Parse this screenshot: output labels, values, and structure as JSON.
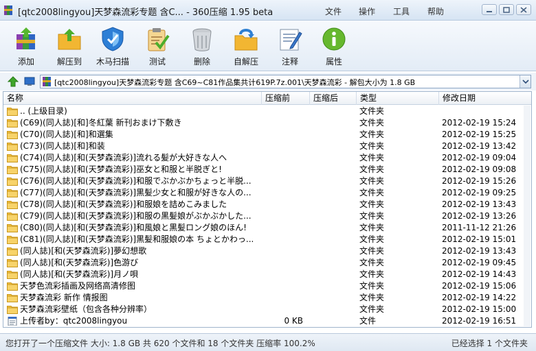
{
  "window": {
    "title": "[qtc2008lingyou]天梦森流彩专题 含C... - 360压缩 1.95 beta",
    "menu": [
      "文件",
      "操作",
      "工具",
      "帮助"
    ]
  },
  "toolbar": {
    "buttons": [
      {
        "label": "添加",
        "icon": "add-archive-icon"
      },
      {
        "label": "解压到",
        "icon": "extract-to-icon"
      },
      {
        "label": "木马扫描",
        "icon": "trojan-scan-shield-icon"
      },
      {
        "label": "测试",
        "icon": "test-clipboard-icon"
      },
      {
        "label": "删除",
        "icon": "trash-icon"
      },
      {
        "label": "自解压",
        "icon": "self-extract-icon"
      },
      {
        "label": "注释",
        "icon": "comment-icon"
      },
      {
        "label": "属性",
        "icon": "info-icon"
      }
    ]
  },
  "address": {
    "path": "[qtc2008lingyou]天梦森流彩专题 含C69~C81作品集共计619P.7z.001\\天梦森流彩 - 解包大小为 1.8 GB"
  },
  "table": {
    "headers": [
      "名称",
      "压缩前",
      "压缩后",
      "类型",
      "修改日期"
    ],
    "rows": [
      {
        "name": ".. (上级目录)",
        "before": "",
        "type": "文件夹",
        "date": "",
        "kind": "folder"
      },
      {
        "name": "(C69)(同人誌)[和]冬紅葉 新刊おまけ下敷き",
        "before": "",
        "type": "文件夹",
        "date": "2012-02-19 15:24",
        "kind": "folder"
      },
      {
        "name": "(C70)(同人誌)[和]和選集",
        "before": "",
        "type": "文件夹",
        "date": "2012-02-19 15:25",
        "kind": "folder"
      },
      {
        "name": "(C73)(同人誌)[和]和装",
        "before": "",
        "type": "文件夹",
        "date": "2012-02-19 13:42",
        "kind": "folder"
      },
      {
        "name": "(C74)(同人誌)[和(天梦森流彩)]流れる髪が大好きな人へ",
        "before": "",
        "type": "文件夹",
        "date": "2012-02-19 09:04",
        "kind": "folder"
      },
      {
        "name": "(C75)(同人誌)[和(天梦森流彩)]巫女と和服と半脱ぎと!",
        "before": "",
        "type": "文件夹",
        "date": "2012-02-19 09:08",
        "kind": "folder"
      },
      {
        "name": "(C76)(同人誌)[和(天梦森流彩)]和服でぶかぶかちょっと半脱...",
        "before": "",
        "type": "文件夹",
        "date": "2012-02-19 15:26",
        "kind": "folder"
      },
      {
        "name": "(C77)(同人誌)[和(天梦森流彩)]黒髪少女と和服が好きな人の...",
        "before": "",
        "type": "文件夹",
        "date": "2012-02-19 09:25",
        "kind": "folder"
      },
      {
        "name": "(C78)(同人誌)[和(天梦森流彩)]和服娘を詰めこみました",
        "before": "",
        "type": "文件夹",
        "date": "2012-02-19 13:43",
        "kind": "folder"
      },
      {
        "name": "(C79)(同人誌)[和(天梦森流彩)]和服の黒髪娘がぶかぶかした...",
        "before": "",
        "type": "文件夹",
        "date": "2012-02-19 13:26",
        "kind": "folder"
      },
      {
        "name": "(C80)(同人誌)[和(天梦森流彩)]和風娘と黒髪ロング娘のほん!",
        "before": "",
        "type": "文件夹",
        "date": "2011-11-12 21:26",
        "kind": "folder"
      },
      {
        "name": "(C81)(同人誌)[和(天梦森流彩)]黒髪和服娘の本 ちょとかわっ...",
        "before": "",
        "type": "文件夹",
        "date": "2012-02-19 15:01",
        "kind": "folder"
      },
      {
        "name": "(同人誌)[和(天梦森流彩)]夢幻想歌",
        "before": "",
        "type": "文件夹",
        "date": "2012-02-19 13:43",
        "kind": "folder"
      },
      {
        "name": "(同人誌)[和(天梦森流彩)]色游び",
        "before": "",
        "type": "文件夹",
        "date": "2012-02-19 09:45",
        "kind": "folder"
      },
      {
        "name": "(同人誌)[和(天梦森流彩)]月ノ唄",
        "before": "",
        "type": "文件夹",
        "date": "2012-02-19 14:43",
        "kind": "folder"
      },
      {
        "name": "天梦色流彩插画及网络高清修图",
        "before": "",
        "type": "文件夹",
        "date": "2012-02-19 15:06",
        "kind": "folder"
      },
      {
        "name": "天梦森流彩 新作 情报图",
        "before": "",
        "type": "文件夹",
        "date": "2012-02-19 14:22",
        "kind": "folder"
      },
      {
        "name": "天梦森流彩壁纸（包含各种分辨率）",
        "before": "",
        "type": "文件夹",
        "date": "2012-02-19 15:00",
        "kind": "folder"
      },
      {
        "name": "上传者by：qtc2008lingyou",
        "before": "0 KB",
        "type": "文件",
        "date": "2012-02-19 16:51",
        "kind": "file"
      }
    ]
  },
  "status": {
    "left": "您打开了一个压缩文件 大小: 1.8 GB 共 620 个文件和 18 个文件夹 压缩率 100.2%",
    "right": "已经选择 1 个文件夹"
  },
  "colors": {
    "folder": "#f3c342",
    "accent": "#3a77c9"
  }
}
